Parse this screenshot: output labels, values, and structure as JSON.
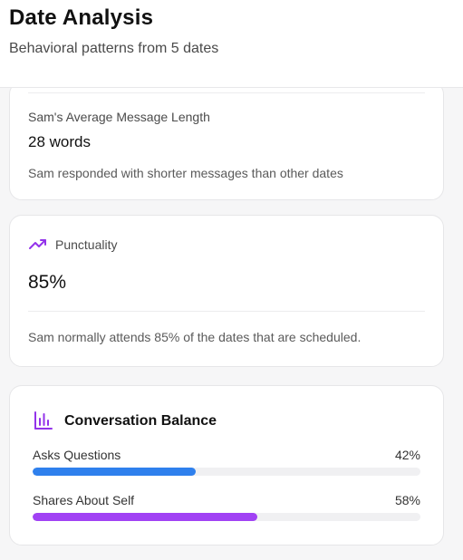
{
  "header": {
    "title": "Date Analysis",
    "subtitle": "Behavioral patterns from 5 dates"
  },
  "message_length_card": {
    "label": "Sam's Average Message Length",
    "value": "28 words",
    "description": "Sam responded with shorter messages than other dates"
  },
  "punctuality_card": {
    "icon": "trending-up-icon",
    "label": "Punctuality",
    "value": "85%",
    "description": "Sam normally attends 85% of the dates that are scheduled."
  },
  "conversation_card": {
    "icon": "bar-chart-icon",
    "title": "Conversation Balance",
    "bars": [
      {
        "label": "Asks Questions",
        "percent_text": "42%",
        "fraction": 0.42,
        "color": "#2f80ed"
      },
      {
        "label": "Shares About Self",
        "percent_text": "58%",
        "fraction": 0.58,
        "color": "#a142f4"
      }
    ]
  },
  "colors": {
    "accent_purple": "#9333ea",
    "blue": "#2f80ed",
    "purple": "#a142f4"
  }
}
